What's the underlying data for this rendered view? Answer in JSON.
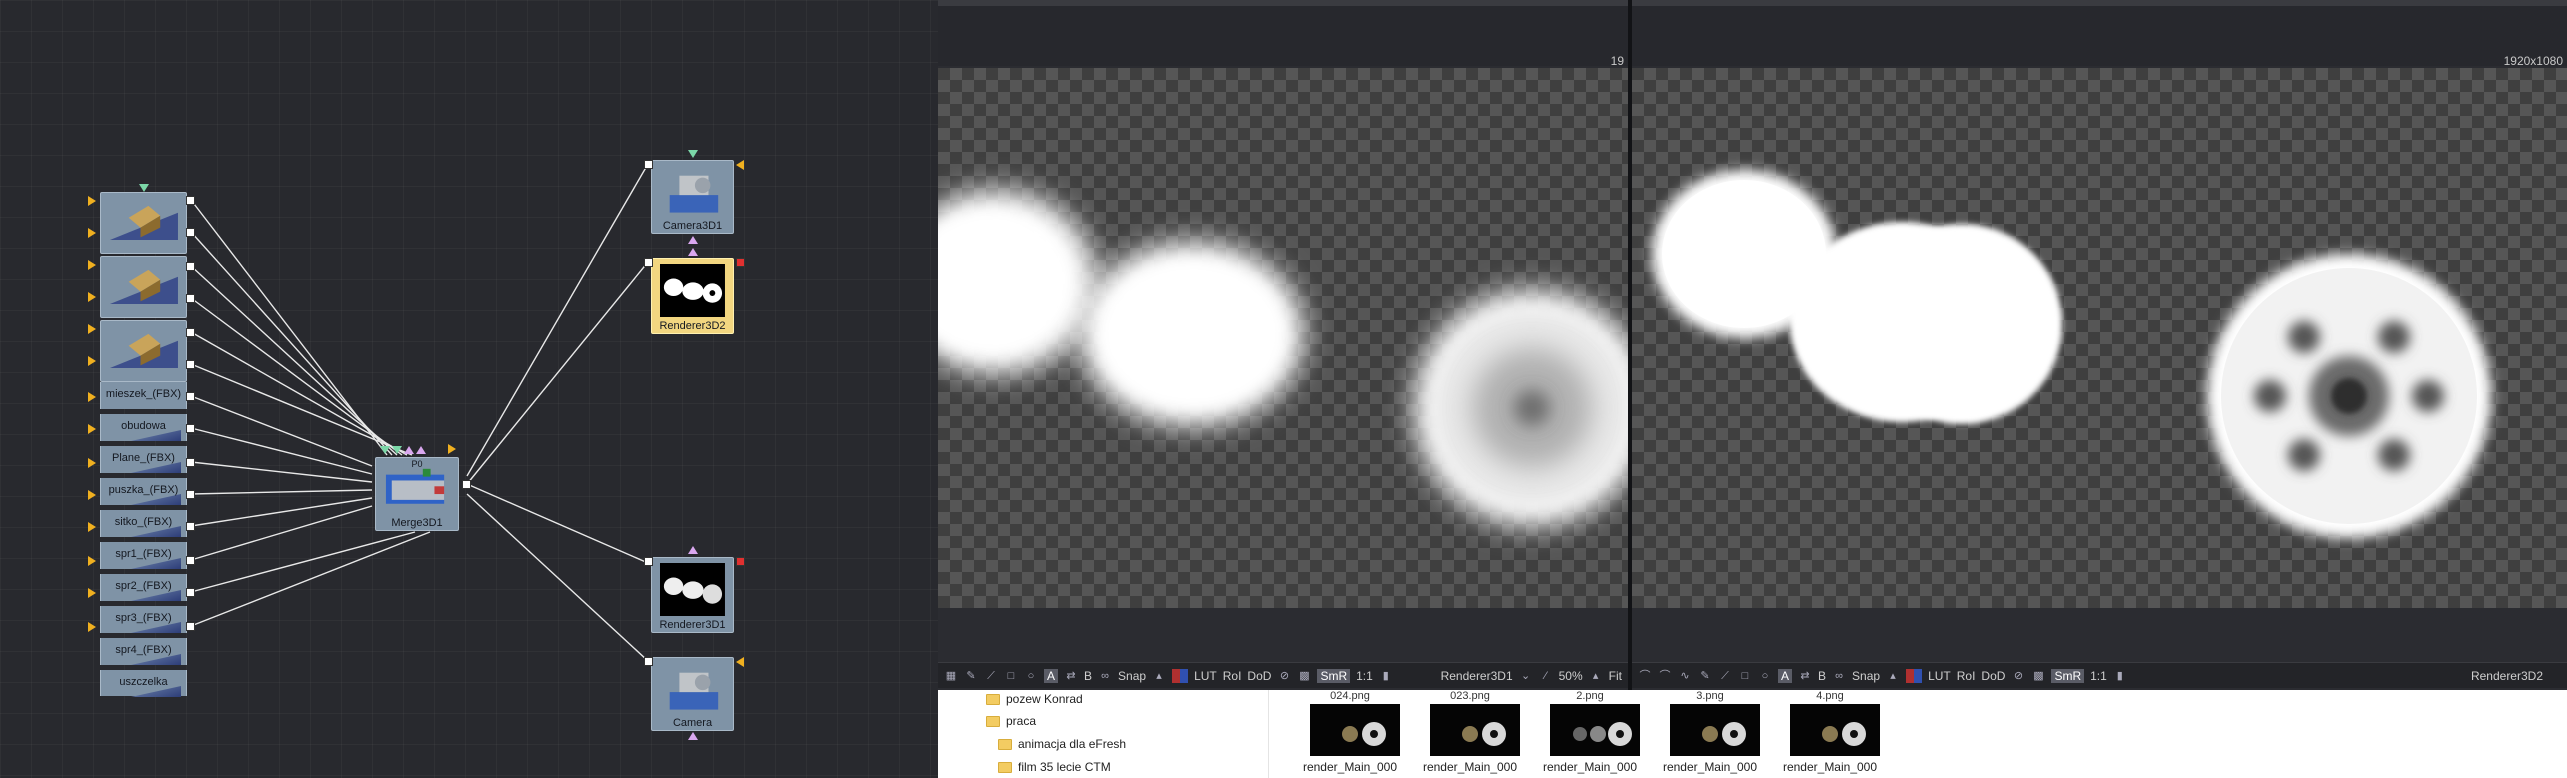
{
  "flow": {
    "merge_label": "Merge3D1",
    "merge_port": "P0",
    "camera_top_label": "Camera3D1",
    "renderer2_label": "Renderer3D2",
    "renderer1_label": "Renderer3D1",
    "camera_label": "Camera",
    "fbx_tiles": [
      "mieszek_(FBX)",
      "obudowa",
      "Plane_(FBX)",
      "puszka_(FBX)",
      "sitko_(FBX)",
      "spr1_(FBX)",
      "spr2_(FBX)",
      "spr3_(FBX)",
      "spr4_(FBX)",
      "uszczelka"
    ]
  },
  "viewer1": {
    "frame_label": "19",
    "toolbar": {
      "snap": "Snap",
      "lut": "LUT",
      "roi": "RoI",
      "dod": "DoD",
      "smr": "SmR",
      "ratio": "1:1",
      "a": "A",
      "b": "B",
      "node_name": "Renderer3D1",
      "zoom": "50%",
      "fit": "Fit"
    }
  },
  "viewer2": {
    "resolution": "1920x1080",
    "toolbar": {
      "snap": "Snap",
      "lut": "LUT",
      "roi": "RoI",
      "dod": "DoD",
      "smr": "SmR",
      "ratio": "1:1",
      "a": "A",
      "b": "B",
      "node_name": "Renderer3D2"
    }
  },
  "files": {
    "folders": [
      "pozew Konrad",
      "praca",
      "animacja dla eFresh",
      "film 35 lecie CTM"
    ],
    "thumbs": [
      {
        "top": "024.png",
        "name": "render_Main_000"
      },
      {
        "top": "023.png",
        "name": "render_Main_000"
      },
      {
        "top": "2.png",
        "name": "render_Main_000"
      },
      {
        "top": "3.png",
        "name": "render_Main_000"
      },
      {
        "top": "4.png",
        "name": "render_Main_000"
      }
    ]
  },
  "colors": {
    "node": "#7f93a6",
    "node_selected": "#f2d680",
    "input_orange": "#f0b020",
    "input_green": "#7bd7a8",
    "input_pink": "#d9a7ef",
    "folder": "#f3cc62"
  }
}
